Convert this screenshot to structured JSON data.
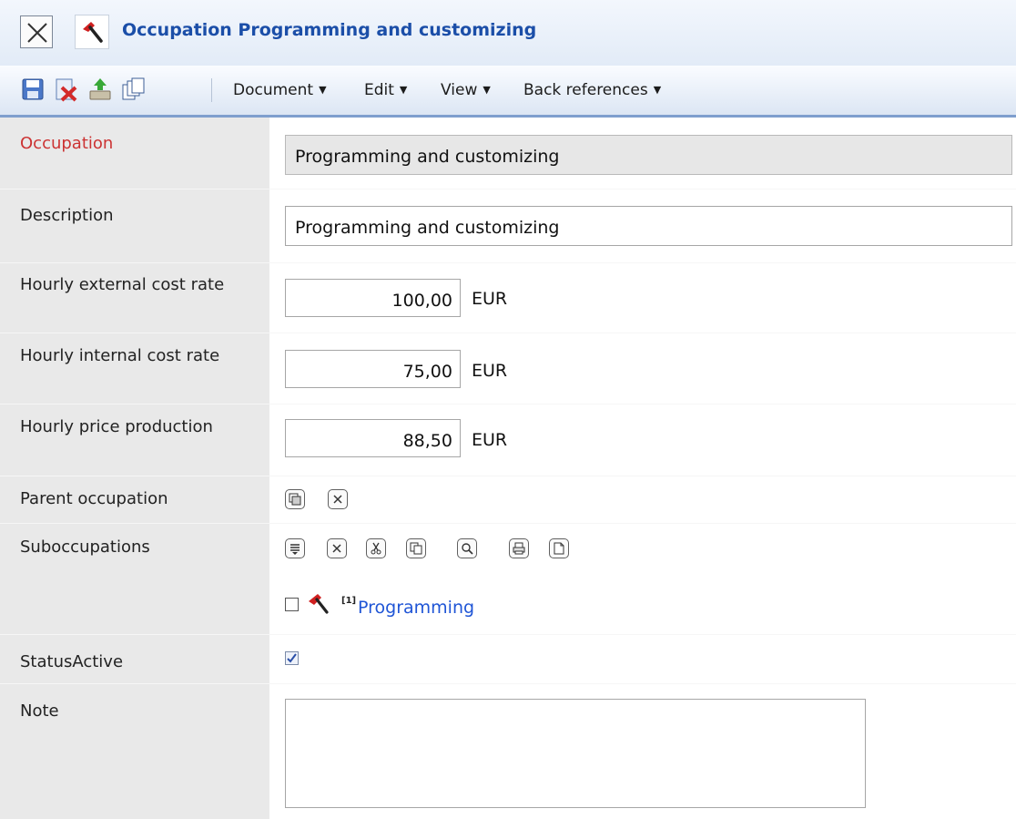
{
  "window": {
    "title": "Occupation Programming and customizing",
    "close_icon": "close-icon",
    "type_icon": "hammer-icon"
  },
  "toolbar": {
    "icons": [
      "save-icon",
      "delete-icon",
      "upload-icon",
      "copy-icon"
    ],
    "menus": [
      {
        "label": "Document"
      },
      {
        "label": "Edit"
      },
      {
        "label": "View"
      },
      {
        "label": "Back references"
      }
    ]
  },
  "form": {
    "occupation": {
      "label": "Occupation",
      "value": "Programming and customizing"
    },
    "description": {
      "label": "Description",
      "value": "Programming and customizing"
    },
    "hourly_external": {
      "label": "Hourly external cost rate",
      "value": "100,00",
      "unit": "EUR"
    },
    "hourly_internal": {
      "label": "Hourly internal cost rate",
      "value": "75,00",
      "unit": "EUR"
    },
    "hourly_price": {
      "label": "Hourly price production",
      "value": "88,50",
      "unit": "EUR"
    },
    "parent_occupation": {
      "label": "Parent occupation",
      "buttons": [
        "select-icon",
        "clear-icon"
      ]
    },
    "suboccupations": {
      "label": "Suboccupations",
      "buttons": [
        "list-icon",
        "remove-icon",
        "cut-icon",
        "copy-icon",
        "search-icon",
        "print-icon",
        "new-document-icon"
      ],
      "items": [
        {
          "index": "[1]",
          "label": "Programming",
          "checked": false
        }
      ]
    },
    "status_active": {
      "label": "StatusActive",
      "checked": true
    },
    "note": {
      "label": "Note",
      "value": ""
    }
  },
  "colors": {
    "title_text": "#1b4ea8",
    "required_label": "#cc3333",
    "link": "#1f55d6",
    "label_column": "#e9e9e9"
  }
}
